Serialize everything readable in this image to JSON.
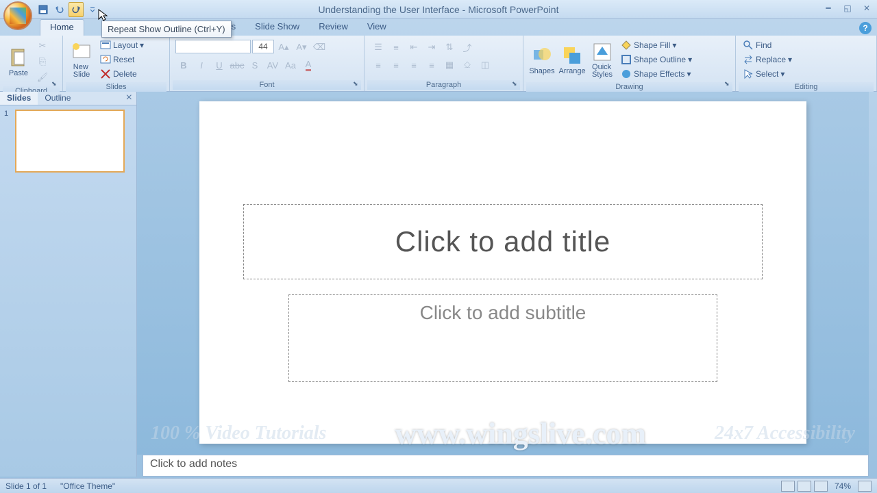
{
  "title": "Understanding the User Interface - Microsoft PowerPoint",
  "tooltip": "Repeat Show Outline (Ctrl+Y)",
  "tabs": {
    "home": "Home",
    "animations_partial": "tions",
    "slideshow": "Slide Show",
    "review": "Review",
    "view": "View"
  },
  "ribbon": {
    "clipboard": {
      "label": "Clipboard",
      "paste": "Paste"
    },
    "slides": {
      "label": "Slides",
      "new_slide": "New\nSlide",
      "layout": "Layout",
      "reset": "Reset",
      "delete": "Delete"
    },
    "font": {
      "label": "Font",
      "size": "44"
    },
    "paragraph": {
      "label": "Paragraph"
    },
    "drawing": {
      "label": "Drawing",
      "shapes": "Shapes",
      "arrange": "Arrange",
      "quick_styles": "Quick\nStyles",
      "fill": "Shape Fill",
      "outline": "Shape Outline",
      "effects": "Shape Effects"
    },
    "editing": {
      "label": "Editing",
      "find": "Find",
      "replace": "Replace",
      "select": "Select"
    }
  },
  "pane": {
    "slides": "Slides",
    "outline": "Outline",
    "num": "1"
  },
  "slide": {
    "title": "Click to add title",
    "subtitle": "Click to add subtitle"
  },
  "notes": "Click to add notes",
  "status": {
    "slide": "Slide 1 of 1",
    "theme": "\"Office Theme\"",
    "zoom": "74%"
  },
  "watermark": {
    "left": "100 % Video Tutorials",
    "center": "www.wingslive.com",
    "right": "24x7 Accessibility"
  }
}
